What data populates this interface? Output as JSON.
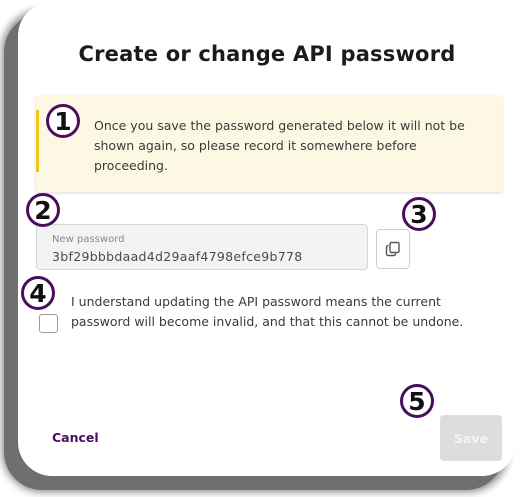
{
  "dialog": {
    "title": "Create or change API password",
    "notice": "Once you save the password generated below it will not be shown again, so please record it somewhere before proceeding.",
    "password_field": {
      "label": "New password",
      "value": "3bf29bbbdaad4d29aaf4798efce9b778"
    },
    "copy_button": {
      "icon": "copy-icon"
    },
    "acknowledge": {
      "checked": false,
      "label": "I understand updating the API password means the current password will become invalid, and that this cannot be undone."
    },
    "cancel_label": "Cancel",
    "save_label": "Save",
    "save_disabled": true
  },
  "callouts": [
    "1",
    "2",
    "3",
    "4",
    "5"
  ],
  "colors": {
    "accent": "#4a0e5e",
    "notice_background": "#fcf8e3",
    "notice_bar": "#f0c419",
    "disabled_button": "#dddddd"
  }
}
